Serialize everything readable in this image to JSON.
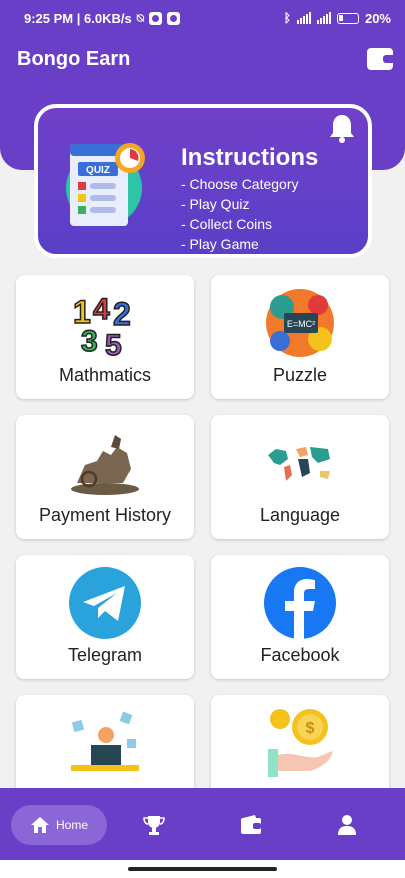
{
  "status_bar": {
    "time_speed": "9:25 PM | 6.0KB/s",
    "battery": "20%"
  },
  "header": {
    "title": "Bongo Earn"
  },
  "instructions": {
    "title": "Instructions",
    "items": [
      "- Choose Category",
      "- Play Quiz",
      "- Collect Coins",
      "- Play Game"
    ],
    "illustration_text": "QUIZ"
  },
  "tiles": [
    {
      "label": "Mathmatics",
      "icon": "numbers-icon"
    },
    {
      "label": "Puzzle",
      "icon": "science-collage-icon"
    },
    {
      "label": "Payment History",
      "icon": "chariot-statue-icon"
    },
    {
      "label": "Language",
      "icon": "world-map-icon"
    },
    {
      "label": "Telegram",
      "icon": "telegram-icon"
    },
    {
      "label": "Facebook",
      "icon": "facebook-icon"
    },
    {
      "label": "",
      "icon": "freelancer-icon"
    },
    {
      "label": "",
      "icon": "coin-hand-icon"
    }
  ],
  "bottom_nav": {
    "home_label": "Home"
  },
  "colors": {
    "primary": "#6a3fc8",
    "home_pill": "#8a66d6",
    "telegram": "#2aa3dc",
    "facebook": "#1877f2"
  }
}
